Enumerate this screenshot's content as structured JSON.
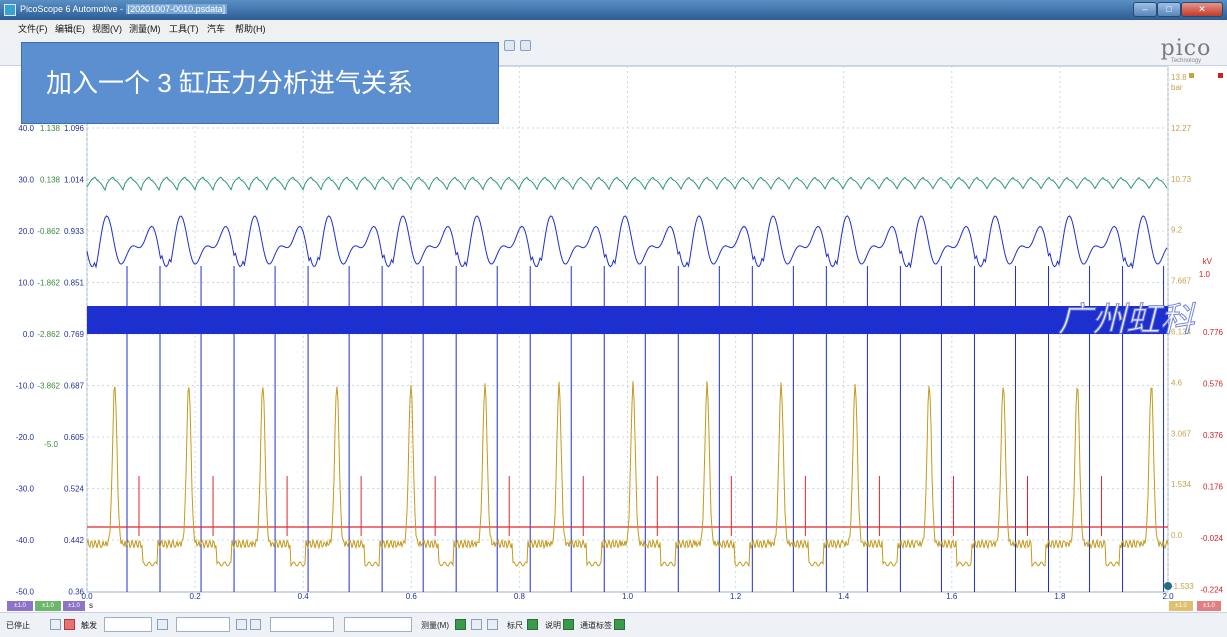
{
  "window": {
    "app_title": "PicoScope 6 Automotive - ",
    "doc_title": "[20201007-0010.psdata]",
    "min_label": "–",
    "max_label": "□",
    "close_label": "✕"
  },
  "menu": [
    "文件(F)",
    "编辑(E)",
    "视图(V)",
    "测量(M)",
    "工具(T)",
    "汽车",
    "帮助(H)"
  ],
  "logo": {
    "word": "pico",
    "sub": "Technology"
  },
  "overlay": {
    "text": "加入一个 3 缸压力分析进气关系"
  },
  "watermark": "广州虹科",
  "axes": {
    "left_a": [
      "40.0",
      "30.0",
      "20.0",
      "10.0",
      "0.0",
      "-10.0",
      "-20.0",
      "-30.0",
      "-40.0",
      "-50.0"
    ],
    "left_b": [
      "1.138",
      "0.138",
      "-0.862",
      "-1.862",
      "-2.862",
      "-3.862",
      "",
      "",
      "",
      ""
    ],
    "left_b_extra": "-5.0",
    "left_c": [
      "1.096",
      "1.014",
      "0.933",
      "0.851",
      "0.769",
      "0.687",
      "0.605",
      "0.524",
      "0.442",
      "0.36"
    ],
    "right_a": [
      "13.8",
      "12.27",
      "10.73",
      "9.2",
      "7.667",
      "6.134",
      "4.6",
      "3.067",
      "1.534",
      "0.0",
      "-1.533"
    ],
    "right_a_unit": "bar",
    "right_b": [
      "0.776",
      "0.576",
      "0.376",
      "0.176",
      "-0.024",
      "-0.224"
    ],
    "right_b_unit": "kV",
    "right_b_top": "1.0",
    "x_ticks": [
      "0.0",
      "0.2",
      "0.4",
      "0.6",
      "0.8",
      "1.0",
      "1.2",
      "1.4",
      "1.6",
      "1.8",
      "2.0"
    ],
    "x_unit": "s"
  },
  "channel_badges": [
    "±1.0",
    "±1.0",
    "±1.0",
    "±1.0",
    "±1.0"
  ],
  "colors": {
    "pressure_green": "#2e9b6b",
    "vacuum_blue": "#1e2fd0",
    "secondary_gold": "#c49a1a",
    "trigger_red": "#e0262b",
    "grid": "#c8d8e6",
    "axis_green": "#3a8a3a",
    "axis_gold": "#c5a34a",
    "axis_red": "#d02020"
  },
  "status": {
    "stopped": "已停止",
    "trigger": "触发",
    "measure": "测量(M)",
    "ruler": "标尺",
    "notes": "说明",
    "channel_labels": "通道标签"
  }
}
